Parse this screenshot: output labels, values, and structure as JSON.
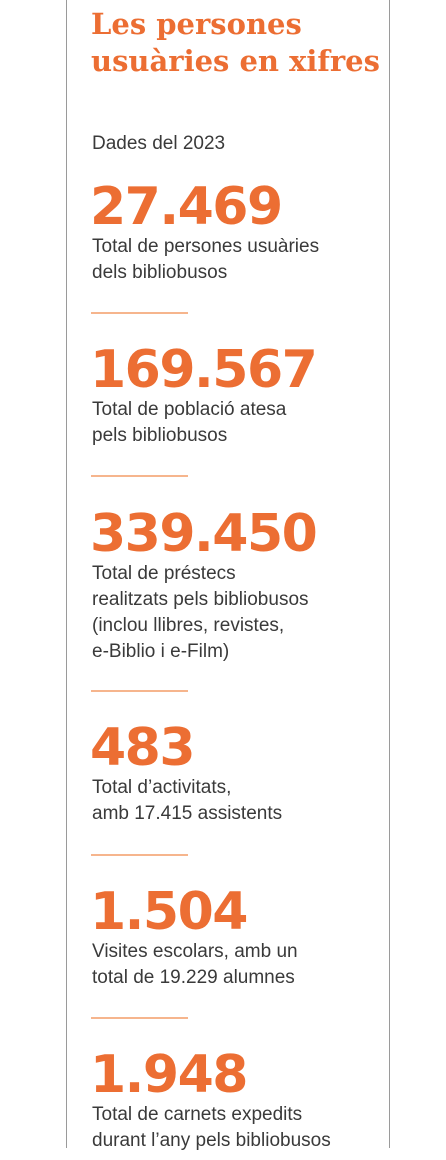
{
  "title": "Les persones usuàries en xifres",
  "subtitle": "Dades del 2023",
  "stats": [
    {
      "value": "27.469",
      "lines": [
        "Total de persones usuàries",
        "dels bibliobusos"
      ]
    },
    {
      "value": "169.567",
      "lines": [
        "Total de població atesa",
        "pels bibliobusos"
      ]
    },
    {
      "value": "339.450",
      "lines": [
        "Total de préstecs",
        "realitzats pels bibliobusos",
        "(inclou llibres, revistes,",
        "e-Biblio i e-Film)"
      ]
    },
    {
      "value": "483",
      "lines": [
        "Total d’activitats,",
        "amb 17.415 assistents"
      ]
    },
    {
      "value": "1.504",
      "lines": [
        "Visites escolars, amb un",
        "total de 19.229 alumnes"
      ]
    },
    {
      "value": "1.948",
      "lines": [
        "Total de carnets expedits",
        "durant l’any pels bibliobusos"
      ]
    }
  ],
  "colors": {
    "accent": "#ec6e33",
    "separator": "#f6b58d",
    "text": "#3a3a3a",
    "rule": "#9a9a9a"
  }
}
